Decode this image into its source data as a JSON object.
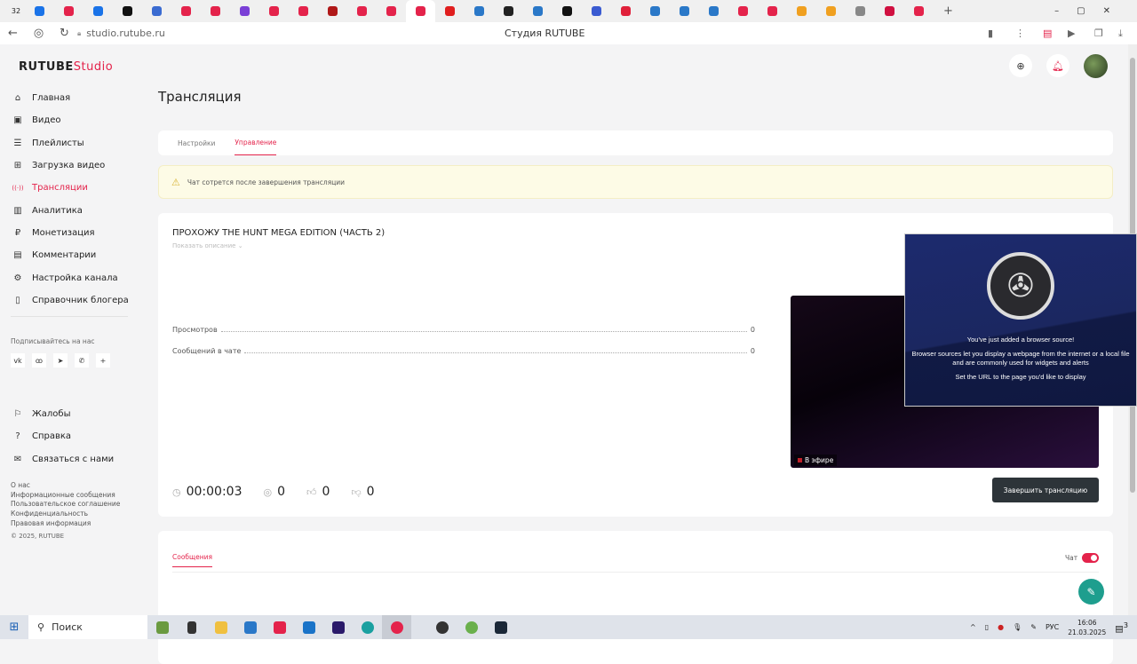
{
  "browser": {
    "tab_count_badge": "32",
    "url": "studio.rutube.ru",
    "page_title": "Студия RUTUBE",
    "tab_colors": [
      "#1a73e8",
      "#e4234b",
      "#1a73e8",
      "#111",
      "#3a6bd1",
      "#e4234b",
      "#e4234b",
      "#7a3fd6",
      "#e4234b",
      "#e4234b",
      "#b01818",
      "#e4234b",
      "#e4234b",
      "#e4234b",
      "#e01e1e",
      "#2a78c8",
      "#222",
      "#2a78c8",
      "#111",
      "#3a5bd1",
      "#e0203a",
      "#2a78c8",
      "#2a78c8",
      "#2a78c8",
      "#e4234b",
      "#e4234b",
      "#f0a020",
      "#f0a020",
      "#888",
      "#d01040",
      "#e4234b"
    ]
  },
  "logo": {
    "brand": "RUTUBE",
    "product": "Studio"
  },
  "page": {
    "title": "Трансляция"
  },
  "sidebar": {
    "items": [
      {
        "label": "Главная",
        "icon": "home-icon",
        "glyph": "⌂"
      },
      {
        "label": "Видео",
        "icon": "video-icon",
        "glyph": "▣"
      },
      {
        "label": "Плейлисты",
        "icon": "list-icon",
        "glyph": "☰"
      },
      {
        "label": "Загрузка видео",
        "icon": "upload-icon",
        "glyph": "⊞"
      },
      {
        "label": "Трансляции",
        "icon": "broadcast-icon",
        "glyph": "((·))",
        "active": true
      },
      {
        "label": "Аналитика",
        "icon": "analytics-icon",
        "glyph": "▥"
      },
      {
        "label": "Монетизация",
        "icon": "ruble-icon",
        "glyph": "₽"
      },
      {
        "label": "Комментарии",
        "icon": "comment-icon",
        "glyph": "▤"
      },
      {
        "label": "Настройка канала",
        "icon": "gear-icon",
        "glyph": "⚙"
      },
      {
        "label": "Справочник блогера",
        "icon": "book-icon",
        "glyph": "▯"
      }
    ],
    "subscribe_label": "Подписывайтесь на нас",
    "socials": [
      {
        "name": "vk",
        "glyph": "vk"
      },
      {
        "name": "ok",
        "glyph": "ꝏ"
      },
      {
        "name": "telegram",
        "glyph": "➤"
      },
      {
        "name": "viber",
        "glyph": "✆"
      },
      {
        "name": "more",
        "glyph": "+"
      }
    ],
    "bottom_items": [
      {
        "label": "Жалобы",
        "glyph": "⚐"
      },
      {
        "label": "Справка",
        "glyph": "?"
      },
      {
        "label": "Связаться с нами",
        "glyph": "✉"
      }
    ],
    "links": [
      "О нас",
      "Информационные сообщения",
      "Пользовательское соглашение",
      "Конфиденциальность",
      "Правовая информация"
    ],
    "copyright": "© 2025, RUTUBE"
  },
  "tabs": [
    {
      "label": "Настройки"
    },
    {
      "label": "Управление",
      "active": true
    }
  ],
  "warning": "Чат сотрется после завершения трансляции",
  "stream": {
    "title": "ПРОХОЖУ THE HUNT MEGA EDITION (ЧАСТЬ 2)",
    "show_description": "Показать описание ⌄",
    "stats": [
      {
        "label": "Просмотров",
        "value": "0"
      },
      {
        "label": "Сообщений в чате",
        "value": "0"
      }
    ],
    "timer": "00:00:03",
    "viewers": "0",
    "likes": "0",
    "dislikes": "0",
    "live_label": "В эфире",
    "end_button": "Завершить трансляцию"
  },
  "chat": {
    "tab": "Сообщения",
    "toggle_label": "Чат",
    "enabled": true
  },
  "obs_overlay": {
    "line1": "You've just added a browser source!",
    "line2": "Browser sources let you display a webpage from the internet or a local file and are commonly used for widgets and alerts",
    "line3": "Set the URL to the page you'd like to display"
  },
  "taskbar": {
    "search": "Поиск",
    "lang": "РУС",
    "time": "16:06",
    "date": "21.03.2025",
    "notifications": "3"
  }
}
